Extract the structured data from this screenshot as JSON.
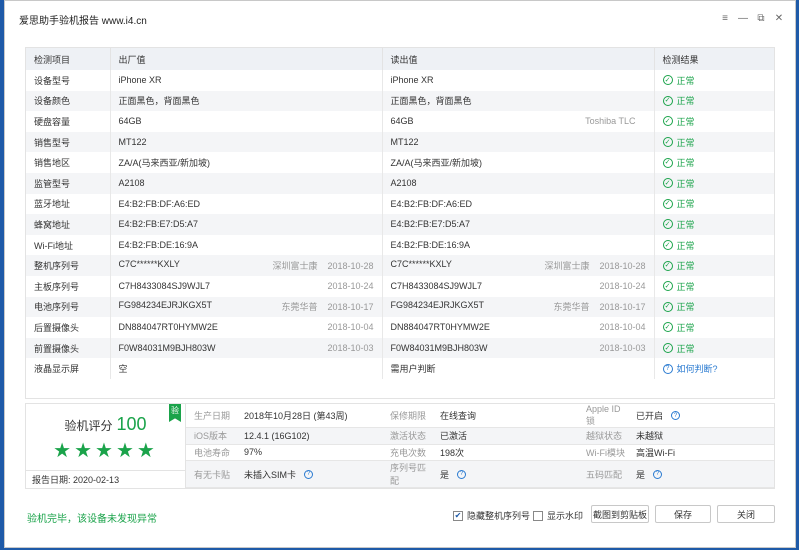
{
  "window": {
    "title": "爱思助手验机报告 www.i4.cn",
    "controls": {
      "menu_icon": "≡",
      "min_icon": "—",
      "restore_icon": "⧉",
      "close_icon": "✕"
    }
  },
  "table": {
    "headers": [
      "检测项目",
      "出厂值",
      "读出值",
      "检测结果"
    ],
    "rows": [
      {
        "item": "设备型号",
        "factory": "iPhone XR",
        "factory_note": "",
        "factory_date": "",
        "read": "iPhone XR",
        "read_note": "",
        "read_date": "",
        "result": "正常",
        "result_type": "ok"
      },
      {
        "item": "设备颜色",
        "factory": "正面黑色，背面黑色",
        "factory_note": "",
        "factory_date": "",
        "read": "正面黑色，背面黑色",
        "read_note": "",
        "read_date": "",
        "result": "正常",
        "result_type": "ok"
      },
      {
        "item": "硬盘容量",
        "factory": "64GB",
        "factory_note": "",
        "factory_date": "",
        "read": "64GB",
        "read_note": "Toshiba TLC",
        "read_date": "",
        "result": "正常",
        "result_type": "ok"
      },
      {
        "item": "销售型号",
        "factory": "MT122",
        "factory_note": "",
        "factory_date": "",
        "read": "MT122",
        "read_note": "",
        "read_date": "",
        "result": "正常",
        "result_type": "ok"
      },
      {
        "item": "销售地区",
        "factory": "ZA/A(马来西亚/新加坡)",
        "factory_note": "",
        "factory_date": "",
        "read": "ZA/A(马来西亚/新加坡)",
        "read_note": "",
        "read_date": "",
        "result": "正常",
        "result_type": "ok"
      },
      {
        "item": "监管型号",
        "factory": "A2108",
        "factory_note": "",
        "factory_date": "",
        "read": "A2108",
        "read_note": "",
        "read_date": "",
        "result": "正常",
        "result_type": "ok"
      },
      {
        "item": "蓝牙地址",
        "factory": "E4:B2:FB:DF:A6:ED",
        "factory_note": "",
        "factory_date": "",
        "read": "E4:B2:FB:DF:A6:ED",
        "read_note": "",
        "read_date": "",
        "result": "正常",
        "result_type": "ok"
      },
      {
        "item": "蜂窝地址",
        "factory": "E4:B2:FB:E7:D5:A7",
        "factory_note": "",
        "factory_date": "",
        "read": "E4:B2:FB:E7:D5:A7",
        "read_note": "",
        "read_date": "",
        "result": "正常",
        "result_type": "ok"
      },
      {
        "item": "Wi-Fi地址",
        "factory": "E4:B2:FB:DE:16:9A",
        "factory_note": "",
        "factory_date": "",
        "read": "E4:B2:FB:DE:16:9A",
        "read_note": "",
        "read_date": "",
        "result": "正常",
        "result_type": "ok"
      },
      {
        "item": "整机序列号",
        "factory": "C7C******KXLY",
        "factory_note": "深圳富士康",
        "factory_date": "2018-10-28",
        "read": "C7C******KXLY",
        "read_note": "深圳富士康",
        "read_date": "2018-10-28",
        "result": "正常",
        "result_type": "ok"
      },
      {
        "item": "主板序列号",
        "factory": "C7H8433084SJ9WJL7",
        "factory_note": "",
        "factory_date": "2018-10-24",
        "read": "C7H8433084SJ9WJL7",
        "read_note": "",
        "read_date": "2018-10-24",
        "result": "正常",
        "result_type": "ok"
      },
      {
        "item": "电池序列号",
        "factory": "FG984234EJRJKGX5T",
        "factory_note": "东莞华普",
        "factory_date": "2018-10-17",
        "read": "FG984234EJRJKGX5T",
        "read_note": "东莞华普",
        "read_date": "2018-10-17",
        "result": "正常",
        "result_type": "ok"
      },
      {
        "item": "后置摄像头",
        "factory": "DN884047RT0HYMW2E",
        "factory_note": "",
        "factory_date": "2018-10-04",
        "read": "DN884047RT0HYMW2E",
        "read_note": "",
        "read_date": "2018-10-04",
        "result": "正常",
        "result_type": "ok"
      },
      {
        "item": "前置摄像头",
        "factory": "F0W84031M9BJH803W",
        "factory_note": "",
        "factory_date": "2018-10-03",
        "read": "F0W84031M9BJH803W",
        "read_note": "",
        "read_date": "2018-10-03",
        "result": "正常",
        "result_type": "ok"
      },
      {
        "item": "液晶显示屏",
        "factory": "空",
        "factory_note": "",
        "factory_date": "",
        "read": "需用户判断",
        "read_note": "",
        "read_date": "",
        "result": "如何判断?",
        "result_type": "q"
      }
    ]
  },
  "summary": {
    "badge": "验",
    "score_label": "验机评分",
    "score": "100",
    "stars": "★★★★★",
    "report_date_label": "报告日期:",
    "report_date": "2020-02-13",
    "fields": [
      {
        "k": "生产日期",
        "v": "2018年10月28日 (第43周)",
        "cls": ""
      },
      {
        "k": "保修期限",
        "v": "在线查询",
        "cls": "link"
      },
      {
        "k": "Apple ID锁",
        "v": "已开启",
        "cls": "red",
        "q": true
      },
      {
        "k": "iOS版本",
        "v": "12.4.1 (16G102)",
        "cls": ""
      },
      {
        "k": "激活状态",
        "v": "已激活",
        "cls": ""
      },
      {
        "k": "越狱状态",
        "v": "未越狱",
        "cls": ""
      },
      {
        "k": "电池寿命",
        "v": "97%",
        "cls": ""
      },
      {
        "k": "充电次数",
        "v": "198次",
        "cls": ""
      },
      {
        "k": "Wi-Fi模块",
        "v": "高温Wi-Fi",
        "cls": ""
      },
      {
        "k": "有无卡贴",
        "v": "未插入SIM卡",
        "cls": "",
        "q": true
      },
      {
        "k": "序列号匹配",
        "v": "是",
        "cls": "green",
        "q": true
      },
      {
        "k": "五码匹配",
        "v": "是",
        "cls": "green",
        "q": true
      }
    ]
  },
  "footer": {
    "status": "验机完毕，该设备未发现异常",
    "hide_serial_label": "隐藏整机序列号",
    "hide_serial_checked": true,
    "watermark_label": "显示水印",
    "watermark_checked": false,
    "screenshot_button": "截图到剪贴板",
    "save_button": "保存",
    "close_button": "关闭"
  },
  "colors": {
    "accent_green": "#1aa34a",
    "link_blue": "#2b7bd1",
    "alert_red": "#e03a3a"
  },
  "icons": {
    "ok": "check-circle-icon",
    "question": "question-circle-icon"
  }
}
